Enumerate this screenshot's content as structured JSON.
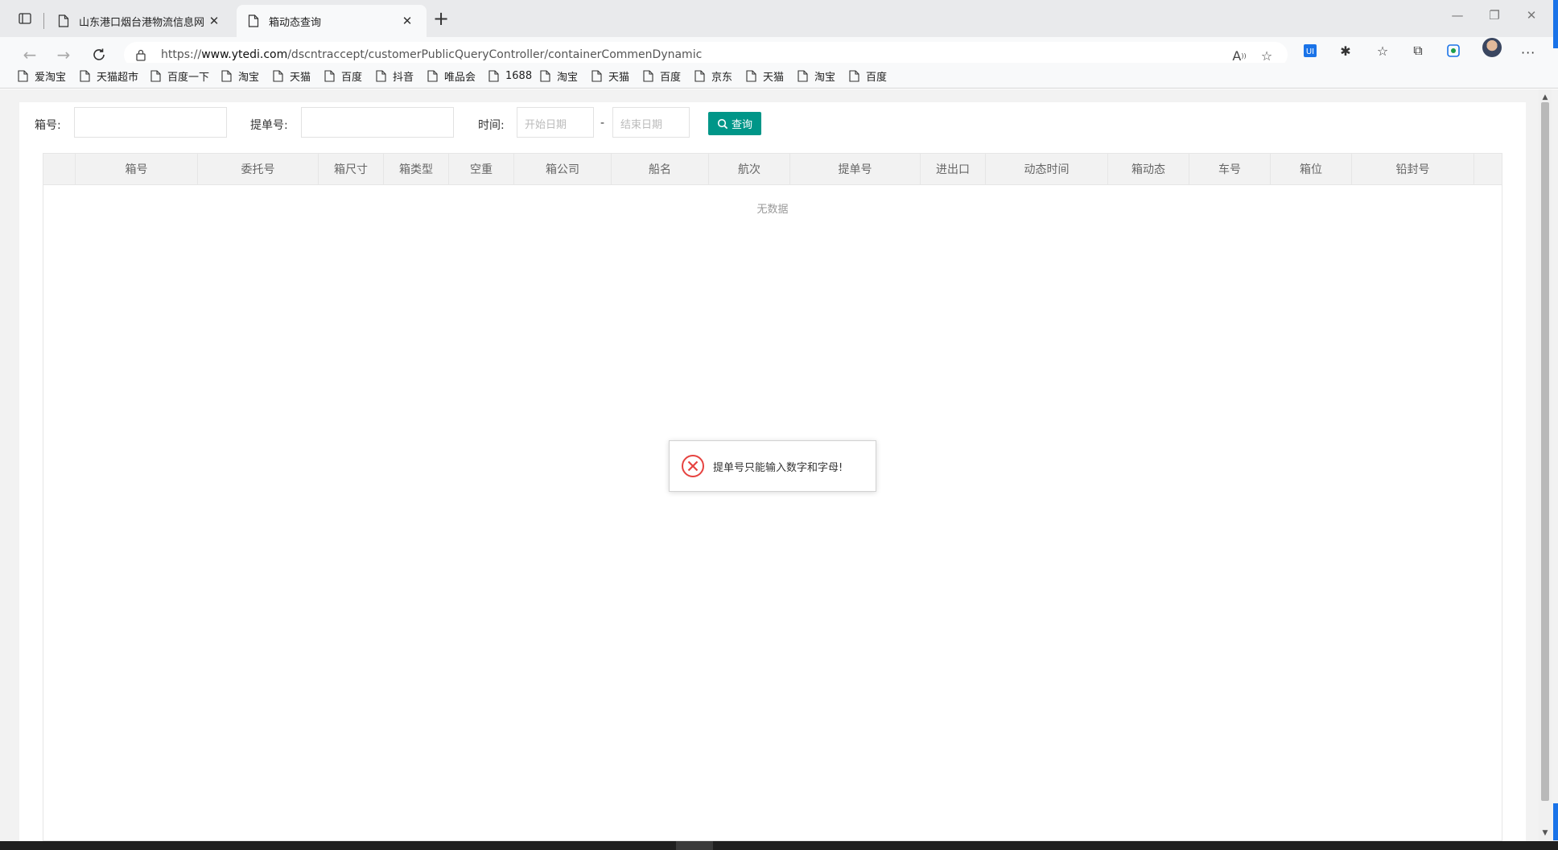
{
  "browser": {
    "tabs": [
      {
        "title": "山东港口烟台港物流信息网",
        "active": false
      },
      {
        "title": "箱动态查询",
        "active": true
      }
    ],
    "url_prefix": "https://",
    "url_host": "www.ytedi.com",
    "url_path": "/dscntraccept/customerPublicQueryController/containerCommenDynamic",
    "bookmarks": [
      "爱淘宝",
      "天猫超市",
      "百度一下",
      "淘宝",
      "天猫",
      "百度",
      "抖音",
      "唯品会",
      "1688",
      "淘宝",
      "天猫",
      "百度",
      "京东",
      "天猫",
      "淘宝",
      "百度"
    ]
  },
  "form": {
    "box_label": "箱号:",
    "bill_label": "提单号:",
    "time_label": "时间:",
    "start_placeholder": "开始日期",
    "date_separator": "-",
    "end_placeholder": "结束日期",
    "query_button": "查询"
  },
  "table": {
    "columns": [
      "箱号",
      "委托号",
      "箱尺寸",
      "箱类型",
      "空重",
      "箱公司",
      "船名",
      "航次",
      "提单号",
      "进出口",
      "动态时间",
      "箱动态",
      "车号",
      "箱位",
      "铅封号"
    ],
    "empty_text": "无数据"
  },
  "toast": {
    "message": "提单号只能输入数字和字母!"
  },
  "colors": {
    "accent": "#009688",
    "error": "#e64340",
    "edge_blue": "#1a73e8"
  }
}
